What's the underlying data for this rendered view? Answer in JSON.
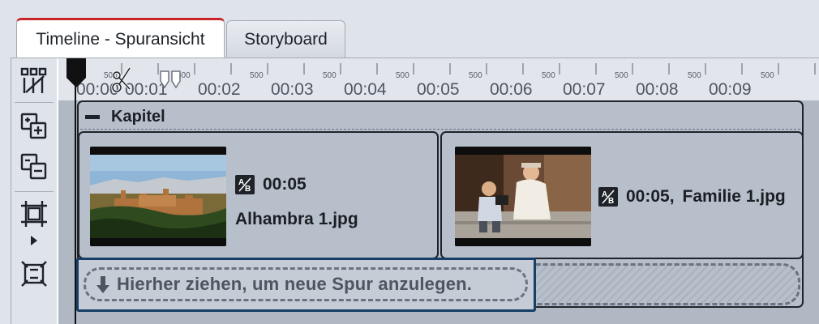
{
  "tabs": [
    {
      "label": "Timeline - Spuransicht",
      "active": true
    },
    {
      "label": "Storyboard",
      "active": false
    }
  ],
  "ruler": {
    "labels": [
      "00:00",
      "00:01",
      "00:02",
      "00:03",
      "00:04",
      "00:05",
      "00:06",
      "00:07",
      "00:08",
      "00:09"
    ],
    "sub_label": "500"
  },
  "chapter": {
    "title": "Kapitel"
  },
  "clips": [
    {
      "duration": "00:05",
      "filename": "Alhambra 1.jpg"
    },
    {
      "duration": "00:05,",
      "filename": "Familie 1.jpg"
    }
  ],
  "dropzone": {
    "text": "Hierher ziehen, um neue Spur anzulegen."
  },
  "colors": {
    "active_tab_accent": "#c8242a",
    "popup_border": "#173e66",
    "timeline_bg": "#b0b8c4"
  },
  "toolbar_icons": [
    "magic-wand-grid-icon",
    "add-track-icon",
    "remove-track-icon",
    "crop-frame-icon",
    "fit-frame-icon"
  ]
}
